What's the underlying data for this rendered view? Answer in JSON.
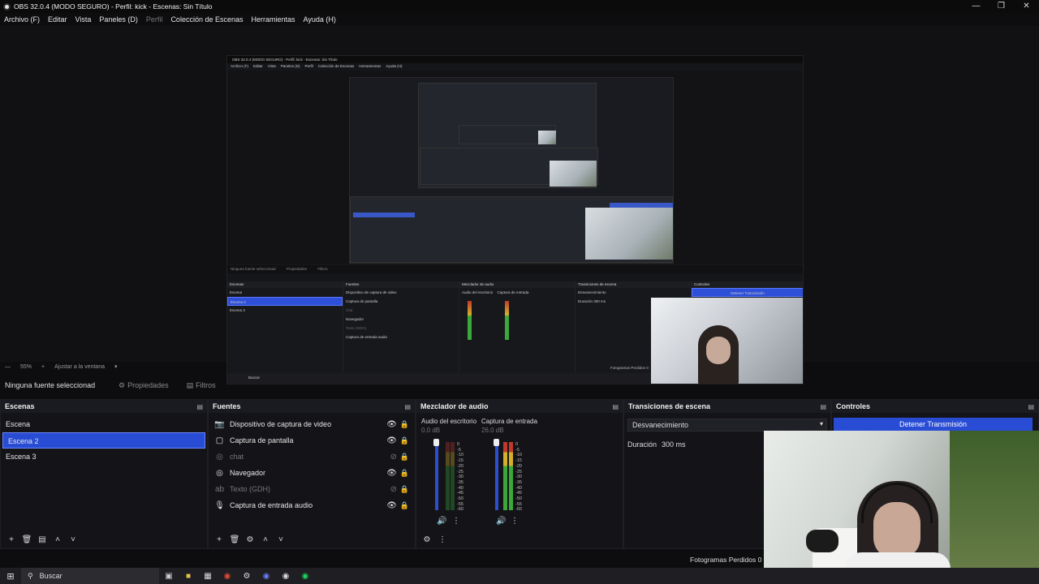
{
  "window": {
    "title": "OBS 32.0.4 (MODO SEGURO) - Perfil: kick - Escenas: Sin Título"
  },
  "menu": [
    "Archivo (F)",
    "Editar",
    "Vista",
    "Paneles (D)",
    "Perfil",
    "Colección de Escenas",
    "Herramientas",
    "Ayuda (H)"
  ],
  "zoom": {
    "value": "55%",
    "plus": "+",
    "fit": "Ajustar a la ventana"
  },
  "sourcebar": {
    "no_selection": "Ninguna fuente seleccionad",
    "properties": "Propiedades",
    "filters": "Filtros"
  },
  "scenes": {
    "title": "Escenas",
    "items": [
      {
        "label": "Escena"
      },
      {
        "label": "Escena 2"
      },
      {
        "label": "Escena 3"
      }
    ],
    "selected": 1
  },
  "sources": {
    "title": "Fuentes",
    "items": [
      {
        "label": "Dispositivo de captura de video",
        "icon": "camera-icon"
      },
      {
        "label": "Captura de pantalla",
        "icon": "monitor-icon"
      },
      {
        "label": "chat",
        "icon": "globe-icon"
      },
      {
        "label": "Navegador",
        "icon": "globe-icon"
      },
      {
        "label": "Texto (GDH)",
        "icon": "text-icon"
      },
      {
        "label": "Captura de entrada audio",
        "icon": "microphone-icon"
      }
    ]
  },
  "mixer": {
    "title": "Mezclador de audio",
    "channels": [
      {
        "name": "Audio del escritorio",
        "db": "0.0 dB"
      },
      {
        "name": "Captura de entrada",
        "db": "26.0 dB"
      }
    ],
    "scale": [
      "0",
      "-5",
      "-10",
      "-15",
      "-20",
      "-25",
      "-30",
      "-35",
      "-40",
      "-45",
      "-50",
      "-55",
      "-60"
    ]
  },
  "transitions": {
    "title": "Transiciones de escena",
    "selected": "Desvanecimiento",
    "duration_label": "Duración",
    "duration_value": "300 ms"
  },
  "controls": {
    "title": "Controles",
    "stop_stream": "Detener Transmisión"
  },
  "status": {
    "frames": "Fotogramas Perdidos 0"
  },
  "taskbar": {
    "search": "Buscar"
  },
  "nested": {
    "title": "OBS 32.0.4 (MODO SEGURO) - Perfil: kick - Escenas: Sin Título",
    "menu": [
      "Archivo (F)",
      "Editar",
      "Vista",
      "Paneles (D)",
      "Perfil",
      "Colección de Escenas",
      "Herramientas",
      "Ayuda (H)"
    ],
    "no_selection": "Ninguna fuente seleccionad",
    "properties": "Propiedades",
    "filters": "Filtros",
    "docks": [
      "Escenas",
      "Fuentes",
      "Mezclador de audio",
      "Transiciones de escena",
      "Controles"
    ],
    "scenes": [
      "Escena",
      "Escena 2",
      "Escena 3"
    ],
    "sources": [
      "Dispositivo de captura de video",
      "Captura de pantalla",
      "chat",
      "Navegador",
      "Texto (GDH)",
      "Captura de entrada audio"
    ],
    "mixer_labels": [
      "Audio del escritorio",
      "Captura de entrada"
    ],
    "transition": "Desvanecimiento",
    "duration": "Duración  300 ms",
    "stop": "Detener Transmisión",
    "frames": "Fotogramas Perdidos 0",
    "search": "Buscar"
  }
}
